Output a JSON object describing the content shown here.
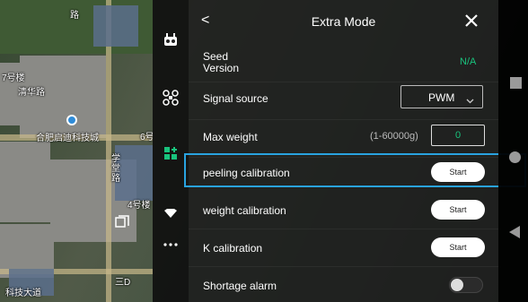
{
  "map": {
    "labels": {
      "building_7": "7号楼",
      "qinghua_road": "清华路",
      "company": "合肥启迪科技城",
      "building_6": "6号",
      "xuetang_road": "学堂路",
      "building_4": "4号楼",
      "road_top": "路",
      "bottom_left": "科技大道",
      "bottom_center": "三D"
    }
  },
  "rail": {
    "icons": [
      "remote-controller-icon",
      "aircraft-icon",
      "plugin-icon",
      "battery-icon",
      "more-icon"
    ],
    "active_color": "#19c37d"
  },
  "panel": {
    "title": "Extra Mode",
    "back_symbol": "<",
    "rows": {
      "seed_version": {
        "label_line1": "Seed",
        "label_line2": "Version",
        "value": "N/A"
      },
      "signal_source": {
        "label": "Signal source",
        "value": "PWM"
      },
      "max_weight": {
        "label": "Max weight",
        "range_hint": "(1-60000g)",
        "value": "0"
      },
      "peeling_calibration": {
        "label": "peeling calibration",
        "button": "Start"
      },
      "weight_calibration": {
        "label": "weight calibration",
        "button": "Start"
      },
      "k_calibration": {
        "label": "K calibration",
        "button": "Start"
      },
      "shortage_alarm": {
        "label": "Shortage alarm",
        "enabled": false
      }
    }
  },
  "colors": {
    "accent_green": "#19c37d",
    "highlight_blue": "#29a3e0"
  }
}
